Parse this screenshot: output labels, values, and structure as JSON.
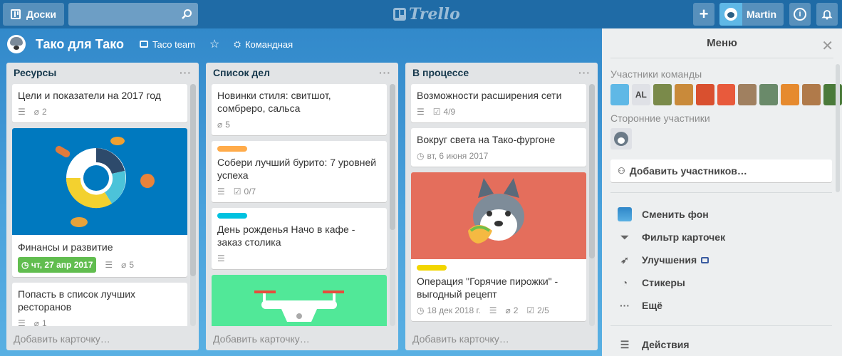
{
  "header": {
    "boards_label": "Доски",
    "logo_text": "Trello",
    "user_name": "Martin"
  },
  "board": {
    "title": "Тако для Тако",
    "team": "Taco team",
    "visibility": "Командная"
  },
  "lists": [
    {
      "title": "Ресурсы",
      "add_card": "Добавить карточку…",
      "cards": [
        {
          "title": "Цели и показатели на 2017 год",
          "attachments": "2"
        },
        {
          "title": "Финансы и развитие",
          "due": "чт, 27 апр 2017",
          "attachments": "5"
        },
        {
          "title": "Попасть в список лучших ресторанов",
          "attachments": "1"
        }
      ]
    },
    {
      "title": "Список дел",
      "add_card": "Добавить карточку…",
      "cards": [
        {
          "title": "Новинки стиля: свитшот, сомбреро, сальса",
          "attachments": "5"
        },
        {
          "title": "Собери лучший бурито: 7 уровней успеха",
          "checklist": "0/7",
          "label_color": "#ffab4a"
        },
        {
          "title": "День рожденья Начо в кафе - заказ столика",
          "label_color": "#00c2e0"
        }
      ]
    },
    {
      "title": "В процессе",
      "add_card": "Добавить карточку…",
      "cards": [
        {
          "title": "Возможности расширения сети",
          "checklist": "4/9"
        },
        {
          "title": "Вокруг света на Тако-фургоне",
          "due": "вт, 6 июня 2017"
        },
        {
          "title": "Операция \"Горячие пирожки\" - выгодный рецепт",
          "due": "18 дек 2018 г.",
          "attachments": "2",
          "checklist": "2/5",
          "label_color": "#f2d600"
        }
      ]
    }
  ],
  "menu": {
    "title": "Меню",
    "team_members": "Участники команды",
    "guests": "Сторонние участники",
    "add_members": "Добавить участников…",
    "items": [
      "Сменить фон",
      "Фильтр карточек",
      "Улучшения",
      "Стикеры",
      "Ещё"
    ],
    "activity": "Действия",
    "member_initials": "AL"
  }
}
